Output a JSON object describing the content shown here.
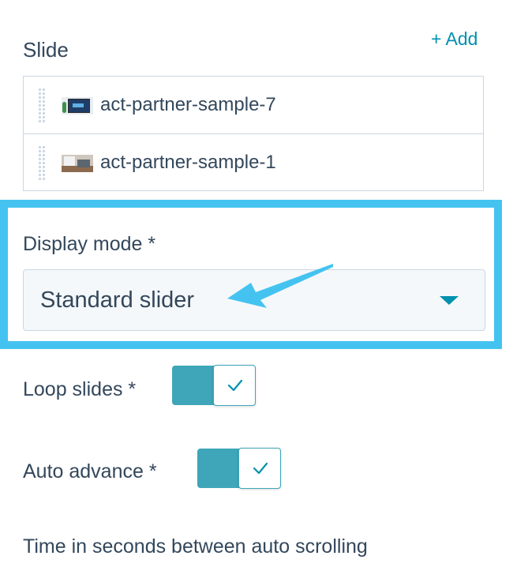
{
  "slide_section": {
    "title": "Slide",
    "add_label": "+ Add",
    "items": [
      {
        "name": "act-partner-sample-7",
        "thumbnail_icon": "office-desk-thumbnail"
      },
      {
        "name": "act-partner-sample-1",
        "thumbnail_icon": "office-meeting-thumbnail"
      }
    ]
  },
  "display_mode": {
    "label": "Display mode *",
    "selected": "Standard slider",
    "highlight_color": "#45c3f0"
  },
  "loop_slides": {
    "label": "Loop slides *",
    "enabled": true
  },
  "auto_advance": {
    "label": "Auto advance *",
    "enabled": true
  },
  "time_between": {
    "label": "Time in seconds between auto scrolling"
  },
  "colors": {
    "accent": "#0091ae",
    "toggle_on": "#3ea6b8",
    "text": "#33475b",
    "border": "#cbd6e2"
  }
}
